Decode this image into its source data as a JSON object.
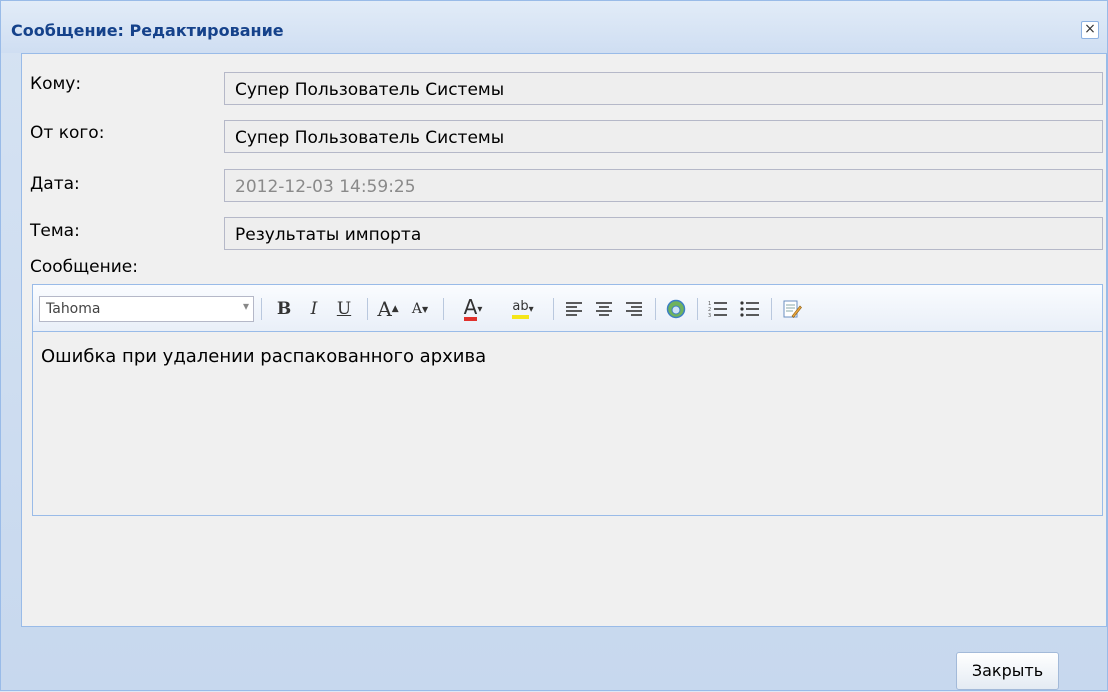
{
  "window": {
    "title": "Сообщение: Редактирование",
    "close_glyph": "×"
  },
  "form": {
    "to_label": "Кому:",
    "to_value": "Супер Пользователь Системы",
    "from_label": "От кого:",
    "from_value": "Супер Пользователь Системы",
    "date_label": "Дата:",
    "date_value": "2012-12-03 14:59:25",
    "subject_label": "Тема:",
    "subject_value": "Результаты импорта",
    "message_label": "Сообщение:"
  },
  "editor": {
    "font_value": "Tahoma",
    "bold": "B",
    "italic": "I",
    "underline": "U",
    "grow_font": "A",
    "shrink_font": "A",
    "font_color": "A",
    "highlight": "ab",
    "content": "Ошибка при удалении распакованного архива",
    "font_color_hex": "#e0312c",
    "highlight_hex": "#f5e61a"
  },
  "footer": {
    "close_button": "Закрыть"
  },
  "icons": [
    "close-icon",
    "chevron-down-icon",
    "align-left-icon",
    "align-center-icon",
    "align-right-icon",
    "link-icon",
    "ordered-list-icon",
    "unordered-list-icon",
    "source-edit-icon"
  ]
}
